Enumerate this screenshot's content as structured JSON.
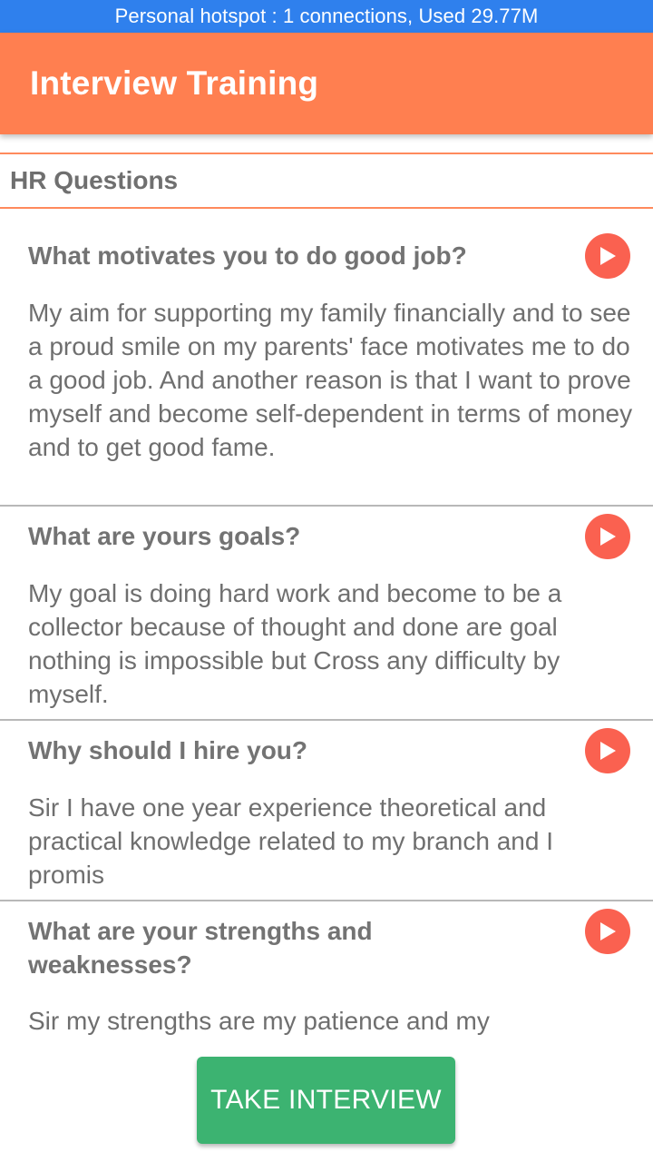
{
  "status_bar": {
    "text": "Personal hotspot : 1 connections, Used 29.77M"
  },
  "app_bar": {
    "title": "Interview Training"
  },
  "section": {
    "title": "HR Questions"
  },
  "items": [
    {
      "question": "What motivates you to do good job?",
      "answer": "My aim for supporting my family financially and to see a proud smile on my parents' face motivates me to do a good job. And another reason is that I want to prove myself and become self-dependent in terms of money and to get good fame."
    },
    {
      "question": "What are yours goals?",
      "answer": "My goal is doing hard work and become to be a collector because of thought and done are goal nothing is impossible but Cross any difficulty by myself."
    },
    {
      "question": "Why should I  hire you?",
      "answer": "Sir I have one year experience theoretical and practical knowledge related to my branch and I promis"
    },
    {
      "question": "What are your strengths and weaknesses?",
      "answer": "Sir my strengths are my patience and my"
    }
  ],
  "actions": {
    "take_interview": "TAKE INTERVIEW"
  },
  "icons": {
    "play": "play-icon"
  },
  "colors": {
    "status_bar": "#2f80ed",
    "app_bar": "#ff7f50",
    "play_button": "#fa6150",
    "take_interview_button": "#3cb371"
  }
}
